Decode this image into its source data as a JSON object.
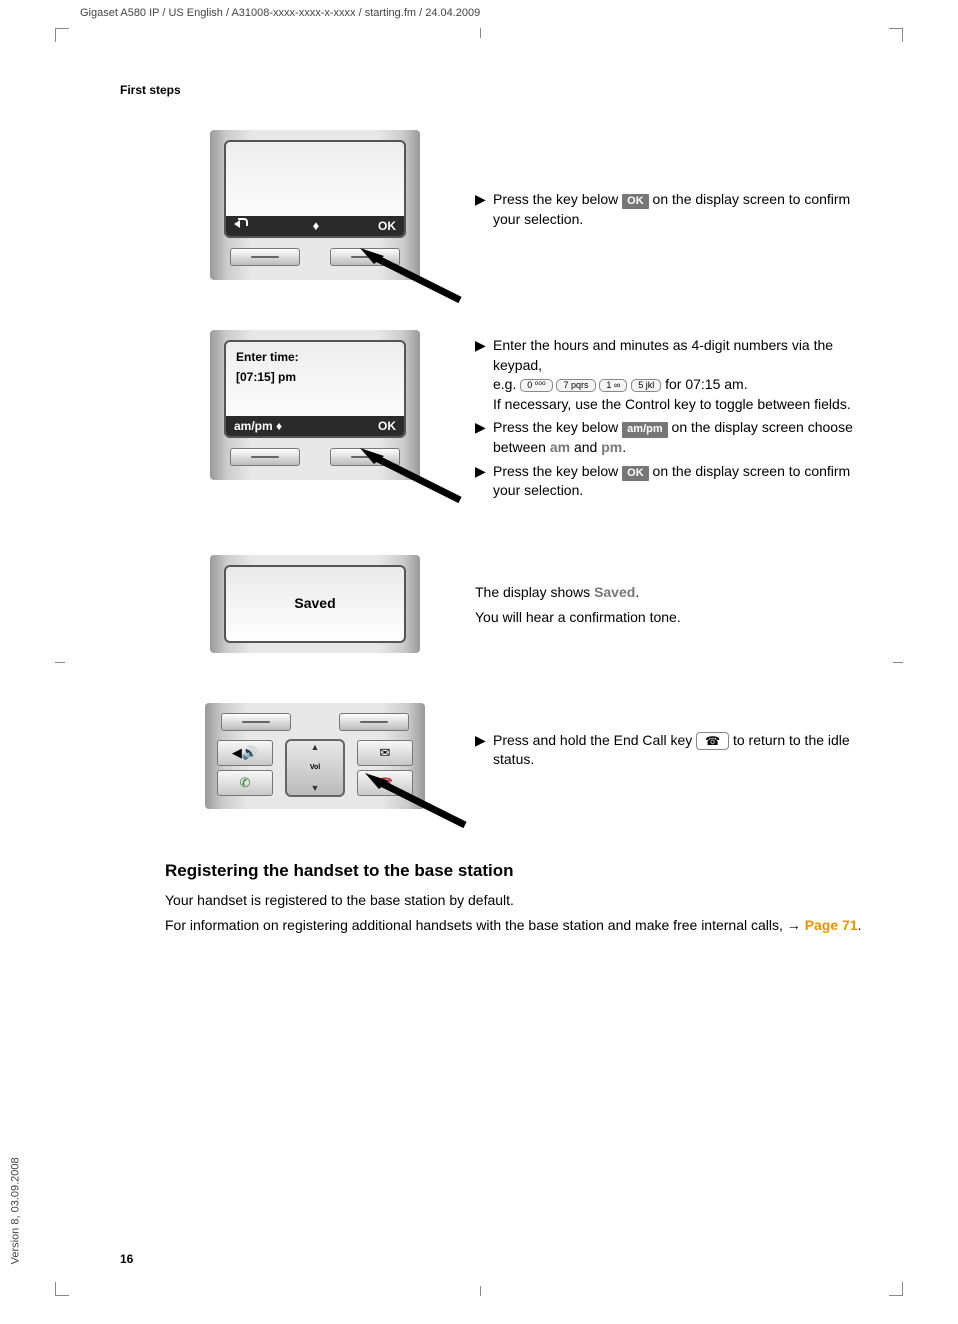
{
  "doc_header": "Gigaset A580 IP / US English / A31008-xxxx-xxxx-x-xxxx / starting.fm / 24.04.2009",
  "running_head": "First steps",
  "page_number": "16",
  "version": "Version 8, 03.09.2008",
  "phone1": {
    "softbar_right": "OK"
  },
  "step1": {
    "text_pre": "Press the key below ",
    "ok": "OK",
    "text_post": " on the display screen to confirm your selection."
  },
  "phone2": {
    "line1": "Enter time:",
    "line2": "[07:15] pm",
    "softbar_left": "am/pm",
    "softbar_right": "OK"
  },
  "step2a": {
    "l1": "Enter the hours and minutes as 4-digit numbers via the keypad,",
    "l2_pre": "e.g. ",
    "k1": "0 ⁰⁰⁰",
    "k2": "7 pqrs",
    "k3": "1 ∞",
    "k4": "5 jkl",
    "l2_post": " for 07:15 am.",
    "l3": "If necessary, use the Control key to toggle between fields."
  },
  "step2b": {
    "pre": "Press the key below ",
    "ampm": "am/pm",
    "mid": " on the display screen     choose between ",
    "am": "am",
    "and": " and ",
    "pm": "pm",
    "post": "."
  },
  "step2c": {
    "pre": "Press the key below ",
    "ok": "OK",
    "post": " on the display screen to confirm your selection."
  },
  "saved": {
    "label": "Saved",
    "line1_pre": "The display shows ",
    "line1_bold": "Saved",
    "line1_post": ".",
    "line2": "You will hear a confirmation tone."
  },
  "step4": {
    "pre": "Press and hold the End Call key ",
    "post": " to return to the idle status."
  },
  "phone4": {
    "nav_label": "Vol"
  },
  "section": {
    "title": "Registering the handset to the base station",
    "p1": "Your handset is registered to the base station by default.",
    "p2_pre": "For information on registering additional handsets with the base station and make free internal calls,  ",
    "arrow": "→",
    "link": "Page 71",
    "p2_post": "."
  }
}
